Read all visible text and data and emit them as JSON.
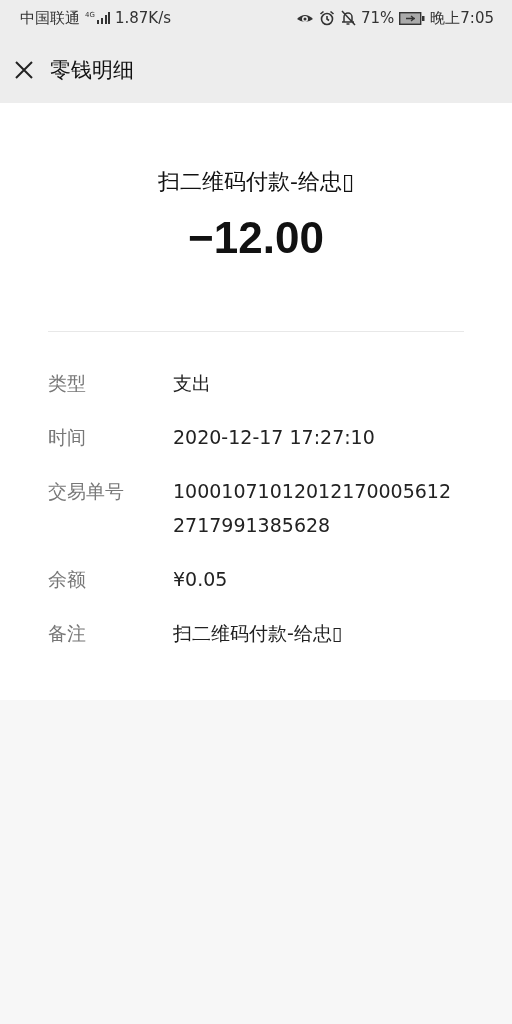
{
  "status_bar": {
    "carrier": "中国联通",
    "network": "4G",
    "speed": "1.87K/s",
    "battery": "71%",
    "time": "晚上7:05"
  },
  "header": {
    "title": "零钱明细"
  },
  "transaction": {
    "title": "扫二维码付款-给忠▯",
    "amount": "−12.00"
  },
  "details": [
    {
      "label": "类型",
      "value": "支出"
    },
    {
      "label": "时间",
      "value": "2020-12-17 17:27:10"
    },
    {
      "label": "交易单号",
      "value": "100010710120121700056122717991385628"
    },
    {
      "label": "余额",
      "value": "¥0.05"
    },
    {
      "label": "备注",
      "value": "扫二维码付款-给忠▯"
    }
  ]
}
